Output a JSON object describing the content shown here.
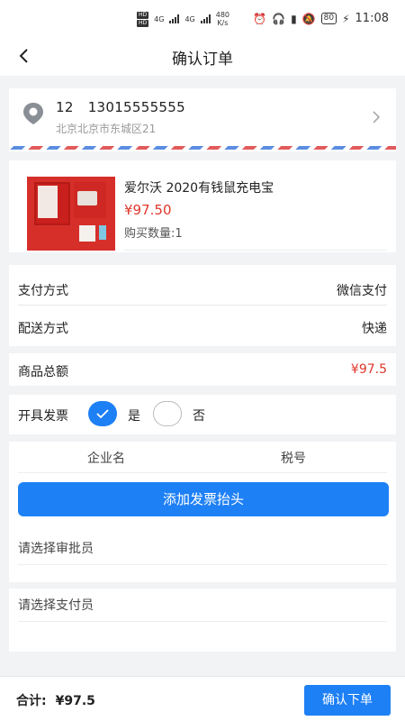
{
  "status_bar": {
    "hd1": "HD",
    "hd2": "HD",
    "net1": "4G",
    "net2": "4G",
    "speed_value": "480",
    "speed_unit": "K/s",
    "battery": "80",
    "time": "11:08"
  },
  "nav": {
    "title": "确认订单"
  },
  "address": {
    "name": "12",
    "phone": "13015555555",
    "detail": "北京北京市东城区21"
  },
  "product": {
    "name": "爱尔沃 2020有钱鼠充电宝",
    "price": "¥97.50",
    "quantity": "购买数量:1"
  },
  "payment": {
    "method_label": "支付方式",
    "method_value": "微信支付",
    "delivery_label": "配送方式",
    "delivery_value": "快递"
  },
  "total_row": {
    "label": "商品总额",
    "value": "¥97.5"
  },
  "invoice": {
    "label": "开具发票",
    "yes": "是",
    "no": "否",
    "selected": "yes",
    "col_company": "企业名",
    "col_tax": "税号",
    "add_button": "添加发票抬头"
  },
  "approver": {
    "placeholder": "请选择审批员"
  },
  "payer": {
    "placeholder": "请选择支付员"
  },
  "footer": {
    "total_label": "合计:",
    "total_amount": "¥97.5",
    "submit_label": "确认下单"
  },
  "colors": {
    "accent": "#1e80f5",
    "price": "#e0372c"
  }
}
